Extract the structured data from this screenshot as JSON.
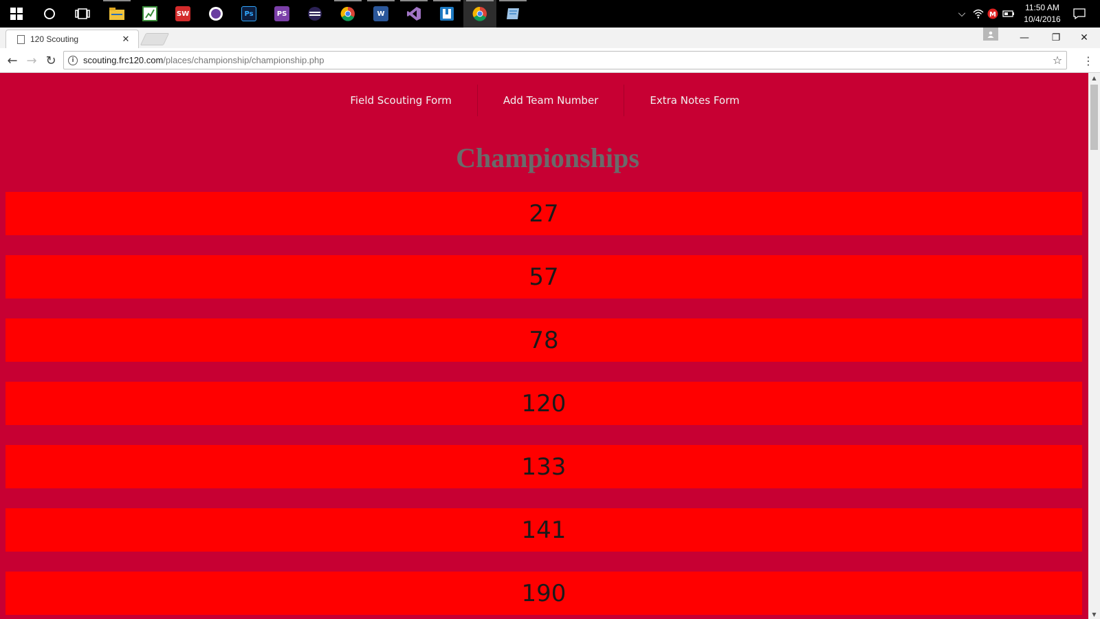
{
  "taskbar": {
    "apps": [
      {
        "name": "start",
        "glyph": "",
        "color": "#000000"
      },
      {
        "name": "cortana",
        "glyph": "",
        "color": "#000000"
      },
      {
        "name": "task-view",
        "glyph": "",
        "color": "#000000"
      },
      {
        "name": "file-explorer",
        "glyph": "",
        "color": "#f0c23b"
      },
      {
        "name": "spreadsheet-app",
        "glyph": "",
        "color": "#3a8d3a"
      },
      {
        "name": "solidworks",
        "glyph": "SW",
        "color": "#d32b2b"
      },
      {
        "name": "purple-app",
        "glyph": "",
        "color": "#6a3fa0"
      },
      {
        "name": "photoshop",
        "glyph": "Ps",
        "color": "#0c1d3d"
      },
      {
        "name": "phpstorm",
        "glyph": "PS",
        "color": "#7b3fa8"
      },
      {
        "name": "eclipse",
        "glyph": "",
        "color": "#2c2255"
      },
      {
        "name": "chrome",
        "glyph": "",
        "color": "#4caf50"
      },
      {
        "name": "word",
        "glyph": "W",
        "color": "#2b579a"
      },
      {
        "name": "visual-studio",
        "glyph": "",
        "color": "#68217a"
      },
      {
        "name": "blue-app",
        "glyph": "",
        "color": "#1e7ac2"
      },
      {
        "name": "chrome-active",
        "glyph": "",
        "color": "#4caf50"
      },
      {
        "name": "notes-app",
        "glyph": "",
        "color": "#6fa8dc"
      }
    ],
    "time": "11:50 AM",
    "date": "10/4/2016"
  },
  "browser": {
    "tab_title": "120 Scouting",
    "tab_close": "✕",
    "url_host": "scouting.frc120.com",
    "url_path": "/places/championship/championship.php",
    "minimize": "—",
    "restore": "❐",
    "close": "✕"
  },
  "page": {
    "nav": [
      "Field Scouting Form",
      "Add Team Number",
      "Extra Notes Form"
    ],
    "heading": "Championships",
    "teams": [
      "27",
      "57",
      "78",
      "120",
      "133",
      "141",
      "190"
    ]
  },
  "colors": {
    "page_bg": "#c70033",
    "row_bg": "#ff0000",
    "heading": "#6a6a6a"
  }
}
